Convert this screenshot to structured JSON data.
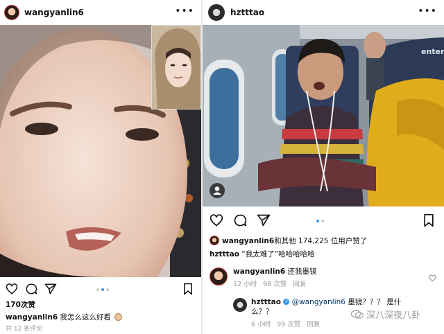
{
  "left_post": {
    "username": "wangyanlin6",
    "likes": "170次赞",
    "caption_user": "wangyanlin6",
    "caption_text": "我怎么这么好看",
    "comments_link": "共 12 条评论"
  },
  "right_post": {
    "username": "hztttao",
    "photo_text": "enter",
    "liked_by_user": "wangyanlin6",
    "liked_by_rest": "和其他 174,225 位用户赞了",
    "caption_user": "hztttao",
    "caption_text": "“我太难了”哈哈哈哈哈",
    "comments": [
      {
        "user": "wangyanlin6",
        "text": "还我墨镜",
        "time": "12 小时",
        "likes": "98 次赞",
        "reply": "回复"
      },
      {
        "user": "hztttao",
        "mention": "@wangyanlin6",
        "text_line1": "墨镜？？？ 是什",
        "text_line2": "么？？",
        "time": "6 小时",
        "likes": "99 次赞",
        "reply": "回复"
      }
    ]
  },
  "watermark": "深八深夜八卦",
  "colors": {
    "accent_blue": "#3897f0",
    "verified_blue": "#3897f0",
    "meta_gray": "#9a9a9a"
  }
}
